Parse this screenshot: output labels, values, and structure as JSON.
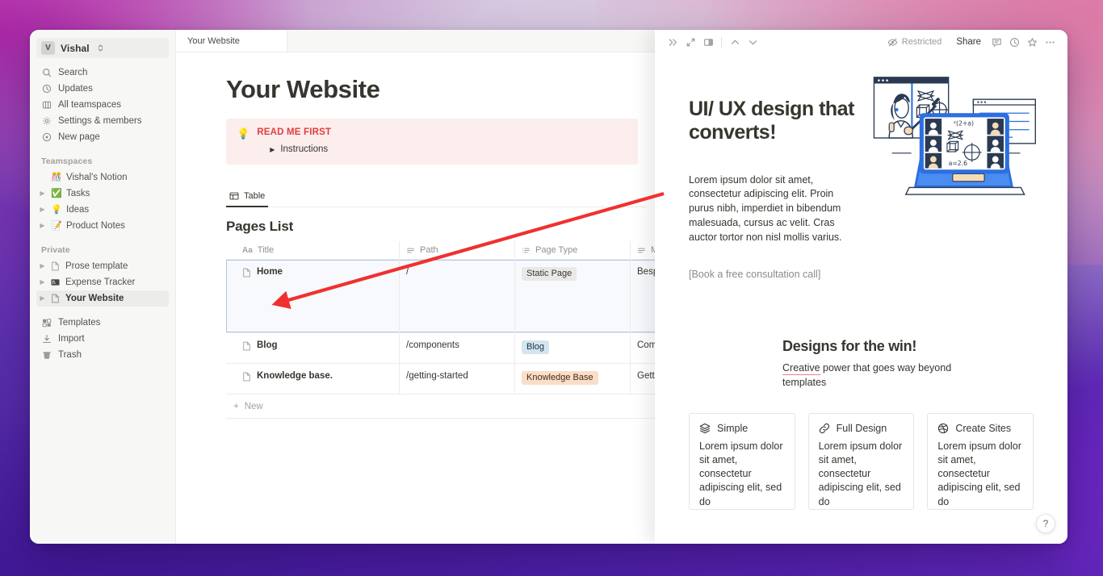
{
  "window": {
    "tab_label": "Your Website"
  },
  "sidebar": {
    "workspace": {
      "initial": "V",
      "name": "Vishal"
    },
    "nav": [
      {
        "label": "Search",
        "icon": "search-icon"
      },
      {
        "label": "Updates",
        "icon": "clock-icon"
      },
      {
        "label": "All teamspaces",
        "icon": "teamspaces-icon"
      },
      {
        "label": "Settings & members",
        "icon": "gear-icon"
      },
      {
        "label": "New page",
        "icon": "new-page-icon"
      }
    ],
    "teamspaces_label": "Teamspaces",
    "teamspaces": [
      {
        "label": "Vishal's Notion",
        "emoji": "🎊",
        "caret": false
      },
      {
        "label": "Tasks",
        "emoji": "✅",
        "caret": true
      },
      {
        "label": "Ideas",
        "emoji": "💡",
        "caret": true
      },
      {
        "label": "Product Notes",
        "emoji": "📝",
        "caret": true
      }
    ],
    "private_label": "Private",
    "private": [
      {
        "label": "Prose template",
        "icon": "page-icon",
        "caret": true,
        "selected": false
      },
      {
        "label": "Expense Tracker",
        "icon": "card-icon",
        "caret": true,
        "selected": false
      },
      {
        "label": "Your Website",
        "icon": "page-icon",
        "caret": true,
        "selected": true
      }
    ],
    "footer": [
      {
        "label": "Templates",
        "icon": "templates-icon"
      },
      {
        "label": "Import",
        "icon": "import-icon"
      },
      {
        "label": "Trash",
        "icon": "trash-icon"
      }
    ]
  },
  "document": {
    "title": "Your Website",
    "callout": {
      "emoji": "💡",
      "title": "READ ME FIRST",
      "toggle_label": "Instructions"
    },
    "view_tab": "Table",
    "database_title": "Pages List",
    "columns": [
      {
        "label": "Title",
        "icon": "aa-icon"
      },
      {
        "label": "Path",
        "icon": "text-icon"
      },
      {
        "label": "Page Type",
        "icon": "select-icon"
      },
      {
        "label": "Me",
        "icon": "text-icon"
      }
    ],
    "rows": [
      {
        "title": "Home",
        "path": "/",
        "page_type": "Static Page",
        "page_type_color": "gray",
        "meta": "Bespo",
        "selected": true
      },
      {
        "title": "Blog",
        "path": "/components",
        "page_type": "Blog",
        "page_type_color": "blue",
        "meta": "Comp",
        "selected": false
      },
      {
        "title": "Knowledge base.",
        "path": "/getting-started",
        "page_type": "Knowledge Base",
        "page_type_color": "orange",
        "meta": "Gettin",
        "selected": false
      }
    ],
    "new_row_label": "New"
  },
  "peek": {
    "toolbar": {
      "collapse_icon": "double-chevron-right-icon",
      "expand_icon": "expand-diagonal-icon",
      "layout_icon": "side-peek-icon",
      "prev_icon": "chevron-up-icon",
      "next_icon": "chevron-down-icon",
      "restricted_label": "Restricted",
      "share_label": "Share",
      "comment_icon": "comment-icon",
      "history_icon": "clock-icon",
      "favorite_icon": "star-icon",
      "more_icon": "ellipsis-icon"
    },
    "hero": {
      "heading": "UI/ UX design that converts!",
      "paragraph": "Lorem ipsum dolor sit amet, consectetur adipiscing elit. Proin purus nibh, imperdiet in bibendum malesuada, cursus ac velit. Cras auctor tortor non nisl mollis varius.",
      "cta": "[Book a free consultation call]",
      "illustration": "online-classroom-video-call-illustration"
    },
    "section2": {
      "heading": "Designs for the win!",
      "link_text": "Creative",
      "body_text": " power that goes way beyond templates"
    },
    "cards": [
      {
        "icon": "layers-icon",
        "title": "Simple",
        "text": "Lorem ipsum dolor sit amet, consectetur adipiscing elit, sed do"
      },
      {
        "icon": "link-icon",
        "title": "Full Design",
        "text": "Lorem ipsum dolor sit amet, consectetur adipiscing elit, sed do"
      },
      {
        "icon": "dribbble-icon",
        "title": "Create Sites",
        "text": "Lorem ipsum dolor sit amet, consectetur adipiscing elit, sed do"
      }
    ],
    "help_label": "?"
  },
  "annotation": {
    "arrow_color": "#f03030",
    "arrow_from": "peek-panel-left-edge",
    "arrow_to": "table-row-home-title"
  }
}
